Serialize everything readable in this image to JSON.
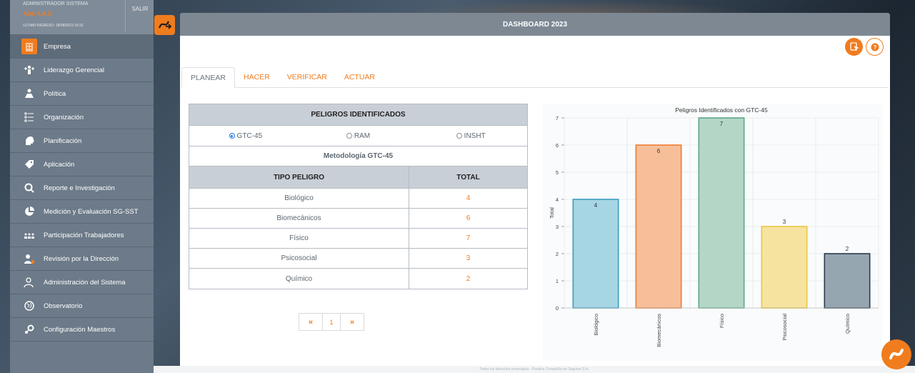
{
  "sidebar": {
    "top_line": "ADMINISTRADOR SISTEMA",
    "company": "ADA S.A.S",
    "last_login": "ULTIMO INGRESO: 18/08/2023 16:31",
    "exit_label": "SALIR",
    "items": [
      {
        "label": "Empresa",
        "icon": "building-icon"
      },
      {
        "label": "Liderazgo Gerencial",
        "icon": "leadership-icon"
      },
      {
        "label": "Política",
        "icon": "policy-icon"
      },
      {
        "label": "Organización",
        "icon": "org-list-icon"
      },
      {
        "label": "Planificación",
        "icon": "planning-head-icon"
      },
      {
        "label": "Aplicación",
        "icon": "tag-icon"
      },
      {
        "label": "Reporte e Investigación",
        "icon": "magnifier-icon"
      },
      {
        "label": "Medición y Evaluación SG-SST",
        "icon": "pie-chart-icon"
      },
      {
        "label": "Participación Trabajadores",
        "icon": "people-icon"
      },
      {
        "label": "Revisión por la Dirección",
        "icon": "review-icon"
      },
      {
        "label": "Administración del Sistema",
        "icon": "admin-user-icon"
      },
      {
        "label": "Observatorio",
        "icon": "globe-icon"
      },
      {
        "label": "Configuración Maestros",
        "icon": "settings-icon"
      }
    ]
  },
  "header": {
    "title": "DASHBOARD 2023"
  },
  "tabs": [
    {
      "label": "PLANEAR",
      "active": true
    },
    {
      "label": "HACER",
      "active": false
    },
    {
      "label": "VERIFICAR",
      "active": false
    },
    {
      "label": "ACTUAR",
      "active": false
    }
  ],
  "hazards_table": {
    "title": "PELIGROS IDENTIFICADOS",
    "options": [
      {
        "label": "GTC-45",
        "selected": true
      },
      {
        "label": "RAM",
        "selected": false
      },
      {
        "label": "INSHT",
        "selected": false
      }
    ],
    "methodology": "Metodología GTC-45",
    "col_type": "TIPO PELIGRO",
    "col_total": "TOTAL",
    "rows": [
      {
        "type": "Biológico",
        "total": "4"
      },
      {
        "type": "Biomecánicos",
        "total": "6"
      },
      {
        "type": "Físico",
        "total": "7"
      },
      {
        "type": "Psicosocial",
        "total": "3"
      },
      {
        "type": "Químico",
        "total": "2"
      }
    ]
  },
  "pager": {
    "prev": "«",
    "page": "1",
    "next": "»"
  },
  "chart_data": {
    "type": "bar",
    "title": "Peligros Identificados con GTC-45",
    "xlabel": "",
    "ylabel": "Total",
    "ylim": [
      0,
      7
    ],
    "yticks": [
      0,
      1,
      2,
      3,
      4,
      5,
      6,
      7
    ],
    "grid": true,
    "categories": [
      "Biológico",
      "Biomecánicos",
      "Físico",
      "Psicosocial",
      "Químico"
    ],
    "values": [
      4,
      6,
      7,
      3,
      2
    ],
    "colors": [
      {
        "fill": "#a6d5e3",
        "stroke": "#3c9cbf"
      },
      {
        "fill": "#f6bf9a",
        "stroke": "#ee7d35"
      },
      {
        "fill": "#b4d6c6",
        "stroke": "#5ea889"
      },
      {
        "fill": "#f6e3a0",
        "stroke": "#e9c640"
      },
      {
        "fill": "#96a6b0",
        "stroke": "#263c4e"
      }
    ]
  },
  "footer": {
    "text": "Todos los derechos reservados - Positiva Compañía de Seguros S.A."
  },
  "colors": {
    "accent": "#f07c1e",
    "sidebar": "#6c7a89",
    "header": "#7d8893"
  }
}
